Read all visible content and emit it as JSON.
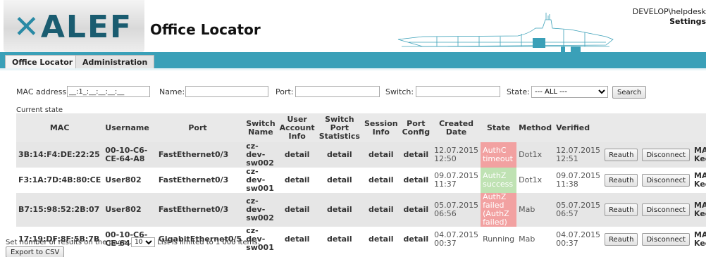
{
  "header": {
    "logo": "ALEF",
    "title": "Office Locator",
    "user": "DEVELOP\\helpdesk",
    "settings": "Settings"
  },
  "tabs": [
    {
      "label": "Office Locator",
      "active": true
    },
    {
      "label": "Administration",
      "active": false
    }
  ],
  "filter": {
    "mac_label": "MAC address:",
    "mac_value": "__:1_:__:__:__:__",
    "name_label": "Name:",
    "name_value": "",
    "port_label": "Port:",
    "port_value": "",
    "switch_label": "Switch:",
    "switch_value": "",
    "state_label": "State:",
    "state_value": "--- ALL ---",
    "search_label": "Search"
  },
  "current_state_label": "Current state",
  "table": {
    "headers": {
      "mac": "MAC",
      "username": "Username",
      "port": "Port",
      "switch_name": "Switch Name",
      "user_account_info": "User Account Info",
      "switch_port_statistics": "Switch Port Statistics",
      "session_info": "Session Info",
      "port_config": "Port Config",
      "created_date": "Created Date",
      "state": "State",
      "method": "Method",
      "verified": "Verified"
    },
    "rows": [
      {
        "mac": "3B:14:F4:DE:22:25",
        "username": "00-10-C6-CE-64-A8",
        "port": "FastEthernet0/3",
        "switch": "cz-dev-sw002",
        "account": "detail",
        "stats": "detail",
        "session": "detail",
        "config": "detail",
        "created": "12.07.2015 12:50",
        "state": "AuthC timeout",
        "state_color": "#f2a1a1",
        "method": "Dot1x",
        "verified": "12.07.2015 12:51",
        "reauth": "Reauth",
        "disconnect": "Disconnect",
        "mab": "MAB Keeper"
      },
      {
        "mac": "F3:1A:7D:4B:80:CE",
        "username": "User802",
        "port": "FastEthernet0/3",
        "switch": "cz-dev-sw001",
        "account": "detail",
        "stats": "detail",
        "session": "detail",
        "config": "detail",
        "created": "09.07.2015 11:37",
        "state": "AuthZ success",
        "state_color": "#bfe2b3",
        "method": "Dot1x",
        "verified": "09.07.2015 11:38",
        "reauth": "Reauth",
        "disconnect": "Disconnect",
        "mab": "MAB Keeper"
      },
      {
        "mac": "B7:15:98:52:2B:07",
        "username": "User802",
        "port": "FastEthernet0/3",
        "switch": "cz-dev-sw002",
        "account": "detail",
        "stats": "detail",
        "session": "detail",
        "config": "detail",
        "created": "05.07.2015 06:56",
        "state": "AuthZ failed (AuthZ failed)",
        "state_color": "#f2a1a1",
        "method": "Mab",
        "verified": "05.07.2015 06:57",
        "reauth": "Reauth",
        "disconnect": "Disconnect",
        "mab": "MAB Keeper"
      },
      {
        "mac": "17:19:DF:8F:5B:7B",
        "username": "00-10-C6-CE-64-A8",
        "port": "GigabitEthernet0/5",
        "switch": "cz-dev-sw001",
        "account": "detail",
        "stats": "detail",
        "session": "detail",
        "config": "detail",
        "created": "04.07.2015 00:37",
        "state": "Running",
        "state_color": "",
        "method": "Mab",
        "verified": "04.07.2015 00:37",
        "reauth": "Reauth",
        "disconnect": "Disconnect",
        "mab": "MAB Keeper"
      }
    ]
  },
  "footer": {
    "results_label": "Set number of results on the page:",
    "results_value": "10",
    "limit_text": "List is limited to 1 000 items.",
    "export_label": "Export to CSV"
  }
}
